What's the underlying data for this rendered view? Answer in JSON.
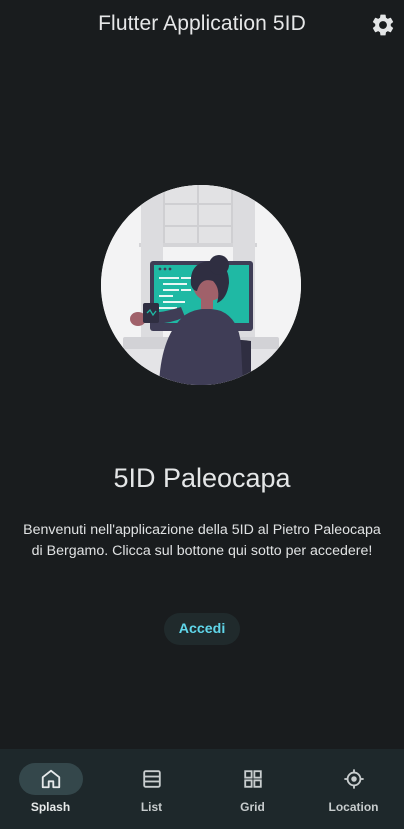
{
  "appbar": {
    "title": "Flutter Application 5ID",
    "settings_icon": "gear-icon"
  },
  "main": {
    "title": "5ID Paleocapa",
    "description": "Benvenuti nell'applicazione della 5ID al Pietro Paleocapa di Bergamo. Clicca sul bottone qui sotto per accedere!",
    "button_label": "Accedi"
  },
  "nav": {
    "items": [
      {
        "label": "Splash",
        "icon": "home-icon",
        "active": true
      },
      {
        "label": "List",
        "icon": "list-icon",
        "active": false
      },
      {
        "label": "Grid",
        "icon": "grid-icon",
        "active": false
      },
      {
        "label": "Location",
        "icon": "location-icon",
        "active": false
      }
    ]
  },
  "colors": {
    "background": "#191c1e",
    "accent": "#60d6ea",
    "navbar": "#1e282b",
    "nav_active_pill": "#34474b"
  }
}
